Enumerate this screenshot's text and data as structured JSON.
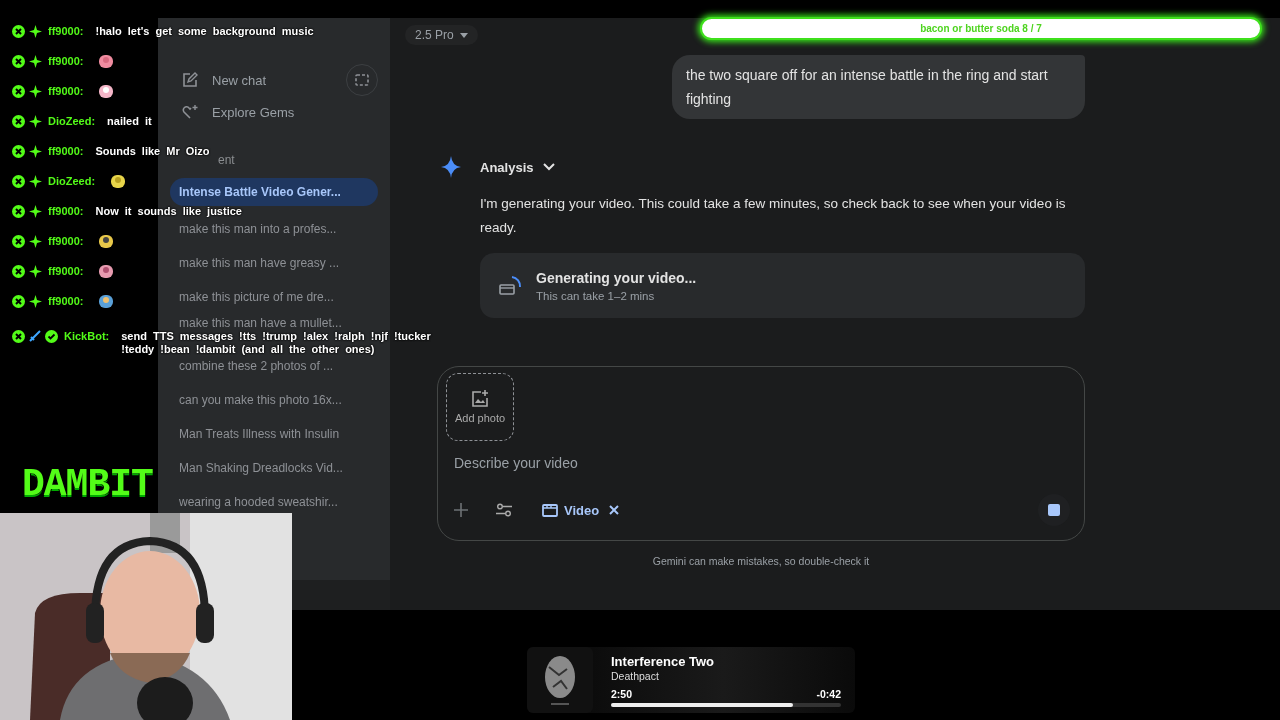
{
  "chat": [
    {
      "kind": "user",
      "user": "ff9000:",
      "message": "!halo let's get some background music"
    },
    {
      "kind": "user",
      "user": "ff9000:",
      "emote": true
    },
    {
      "kind": "user",
      "user": "ff9000:",
      "emote": true
    },
    {
      "kind": "user",
      "user": "DioZeed:",
      "message": "nailed it"
    },
    {
      "kind": "user",
      "user": "ff9000:",
      "message": "Sounds like Mr Oizo"
    },
    {
      "kind": "user",
      "user": "DioZeed:",
      "emote": true
    },
    {
      "kind": "user",
      "user": "ff9000:",
      "message": "Now it sounds like justice"
    },
    {
      "kind": "user",
      "user": "ff9000:",
      "emote": true
    },
    {
      "kind": "user",
      "user": "ff9000:",
      "emote": true
    },
    {
      "kind": "user",
      "user": "ff9000:",
      "emote": true
    },
    {
      "kind": "bot",
      "user": "KickBot:",
      "message": "send TTS messages !tts !trump !alex !ralph !njf !tucker !teddy !bean !dambit (and all the other ones)"
    }
  ],
  "goal_bar": {
    "text": "bacon or butter soda 8 / 7"
  },
  "logo": "DAMBIT",
  "app": {
    "model": "2.5 Pro",
    "sidebar": {
      "actions": [
        {
          "label": "New chat"
        },
        {
          "label": "Explore Gems"
        }
      ],
      "section": "ent",
      "chats": [
        {
          "label": "Intense Battle Video Gener...",
          "selected": true
        },
        {
          "label": "make this man into a profes...",
          "selected": false
        },
        {
          "label": "make this man have greasy ...",
          "selected": false
        },
        {
          "label": "make this picture of me dre...",
          "selected": false
        },
        {
          "label": "make this man have a mullet...",
          "selected": false
        },
        {
          "label": "combine these 2 photos of ...",
          "selected": false
        },
        {
          "label": "can you make this photo 16x...",
          "selected": false
        },
        {
          "label": "Man Treats Illness with Insulin",
          "selected": false
        },
        {
          "label": "Man Shaking Dreadlocks Vid...",
          "selected": false
        },
        {
          "label": "wearing a hooded sweatshir...",
          "selected": false
        }
      ]
    },
    "user_message": "the two square off for an intense battle in the ring and start fighting",
    "response": {
      "title": "Analysis",
      "text": "I'm generating your video. This could take a few minutes, so check back to see when your video is ready.",
      "status": {
        "title": "Generating your video...",
        "subtitle": "This can take 1–2 mins"
      }
    },
    "composer": {
      "add_photo": "Add photo",
      "placeholder": "Describe your video",
      "chip": "Video"
    },
    "disclaimer": "Gemini can make mistakes, so double-check it"
  },
  "player": {
    "title": "Interference Two",
    "artist": "Deathpact",
    "elapsed": "2:50",
    "remaining": "-0:42",
    "level": 0.79
  }
}
